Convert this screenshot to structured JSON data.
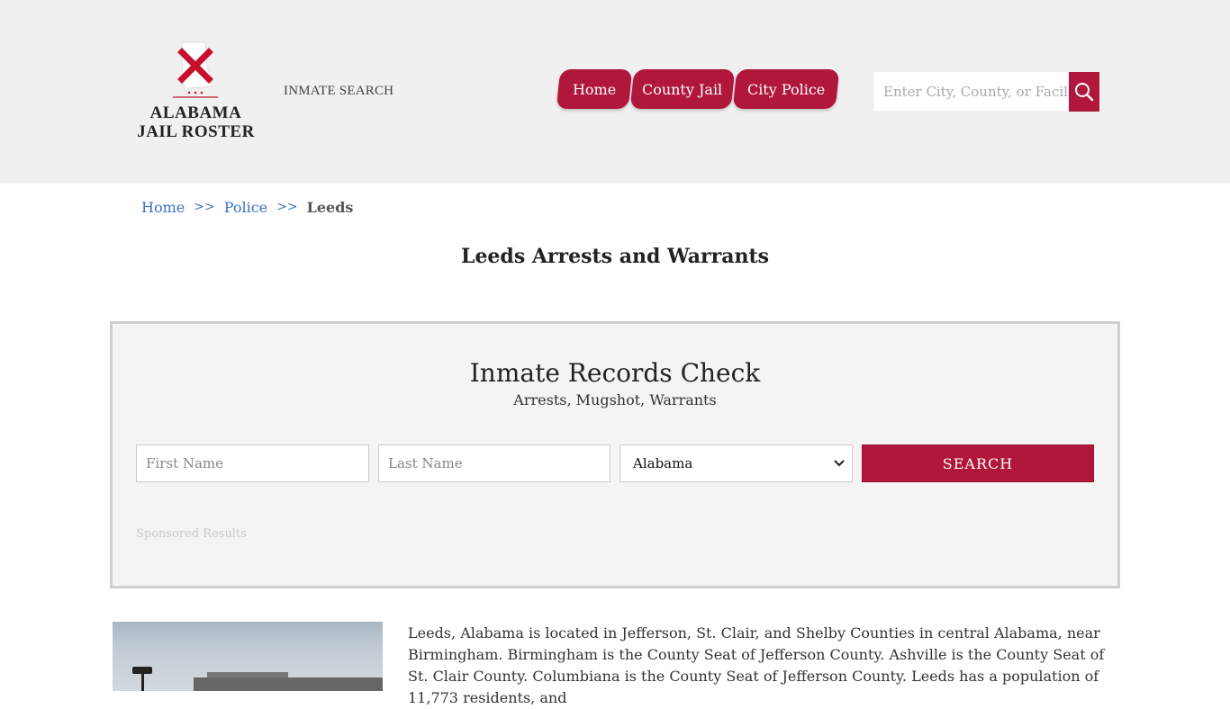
{
  "header": {
    "logo": {
      "line1": "ALABAMA",
      "line2": "JAIL ROSTER",
      "flag_color": "#c8102e"
    },
    "inmate_search_label": "INMATE SEARCH",
    "nav": [
      {
        "label": "Home"
      },
      {
        "label": "County Jail"
      },
      {
        "label": "City Police"
      }
    ],
    "search": {
      "placeholder": "Enter City, County, or Facility"
    }
  },
  "breadcrumb": {
    "items": [
      "Home",
      "Police"
    ],
    "separator": ">>",
    "current": "Leeds"
  },
  "page_title": "Leeds Arrests and Warrants",
  "records_check": {
    "title": "Inmate Records Check",
    "subtitle": "Arrests, Mugshot, Warrants",
    "first_name_placeholder": "First Name",
    "last_name_placeholder": "Last Name",
    "state_selected": "Alabama",
    "search_label": "SEARCH",
    "sponsored_label": "Sponsored Results"
  },
  "article": {
    "text": "Leeds, Alabama is located in Jefferson, St. Clair, and Shelby Counties in central Alabama, near Birmingham. Birmingham is the County Seat of Jefferson County. Ashville is the County Seat of St. Clair County. Columbiana is the County Seat of Jefferson County. Leeds has a population of 11,773 residents, and"
  },
  "colors": {
    "brand": "#b0173a",
    "link": "#3a6fc4",
    "header_bg": "#f0f0f0"
  }
}
